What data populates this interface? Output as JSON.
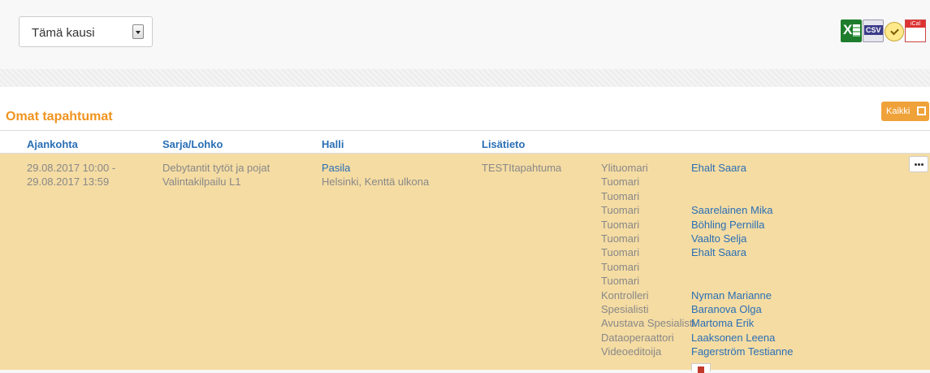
{
  "season_select": {
    "value": "Tämä kausi"
  },
  "exports": [
    {
      "icon": "excel-export-icon"
    },
    {
      "icon": "csv-export-icon",
      "label": "CSV"
    },
    {
      "icon": "calendar-subscribe-icon"
    },
    {
      "icon": "ical-export-icon",
      "label": "iCal"
    }
  ],
  "section": {
    "title": "Omat tapahtumat",
    "all_button": "Kaikki"
  },
  "table": {
    "headers": [
      "Ajankohta",
      "Sarja/Lohko",
      "Halli",
      "Lisätieto"
    ],
    "rows": [
      {
        "time_start": "29.08.2017 10:00 -",
        "time_end": "29.08.2017 13:59",
        "series": "Debytantit tytöt ja pojat",
        "block": "Valintakilpailu L1",
        "venue": "Pasila",
        "venue_detail": "Helsinki, Kenttä ulkona",
        "info": "TESTItapahtuma",
        "officials": [
          {
            "role": "Ylituomari",
            "name": "Ehalt Saara"
          },
          {
            "role": "Tuomari",
            "name": ""
          },
          {
            "role": "Tuomari",
            "name": ""
          },
          {
            "role": "Tuomari",
            "name": "Saarelainen Mika"
          },
          {
            "role": "Tuomari",
            "name": "Böhling Pernilla"
          },
          {
            "role": "Tuomari",
            "name": "Vaalto Selja"
          },
          {
            "role": "Tuomari",
            "name": "Ehalt Saara"
          },
          {
            "role": "Tuomari",
            "name": ""
          },
          {
            "role": "Tuomari",
            "name": ""
          },
          {
            "role": "Kontrolleri",
            "name": "Nyman Marianne"
          },
          {
            "role": "Spesialisti",
            "name": "Baranova Olga"
          },
          {
            "role": "Avustava Spesialisti",
            "name": "Martoma Erik"
          },
          {
            "role": "Dataoperaattori",
            "name": "Laaksonen Leena"
          },
          {
            "role": "Videoeditoija",
            "name": "Fagerström Testianne"
          }
        ]
      }
    ]
  }
}
